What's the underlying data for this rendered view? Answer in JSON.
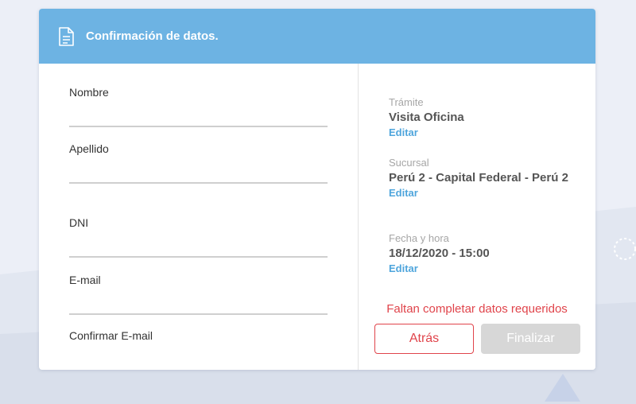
{
  "colors": {
    "header_bg": "#6db3e3",
    "link": "#4ea5dc",
    "error": "#e0444b",
    "disabled_button": "#d7d7d7"
  },
  "header": {
    "icon": "document-icon",
    "title": "Confirmación de datos."
  },
  "form": {
    "fields": [
      {
        "label": "Nombre",
        "value": ""
      },
      {
        "label": "Apellido",
        "value": ""
      },
      {
        "label": "DNI",
        "value": ""
      },
      {
        "label": "E-mail",
        "value": ""
      },
      {
        "label": "Confirmar E-mail",
        "value": ""
      }
    ]
  },
  "summary": {
    "tramite": {
      "label": "Trámite",
      "value": "Visita Oficina",
      "edit": "Editar"
    },
    "sucursal": {
      "label": "Sucursal",
      "value": "Perú 2 - Capital Federal - Perú 2",
      "edit": "Editar"
    },
    "fecha": {
      "label": "Fecha y hora",
      "value": "18/12/2020 - 15:00",
      "edit": "Editar"
    }
  },
  "error_message": "Faltan completar datos requeridos",
  "buttons": {
    "back": "Atrás",
    "finish": "Finalizar"
  }
}
